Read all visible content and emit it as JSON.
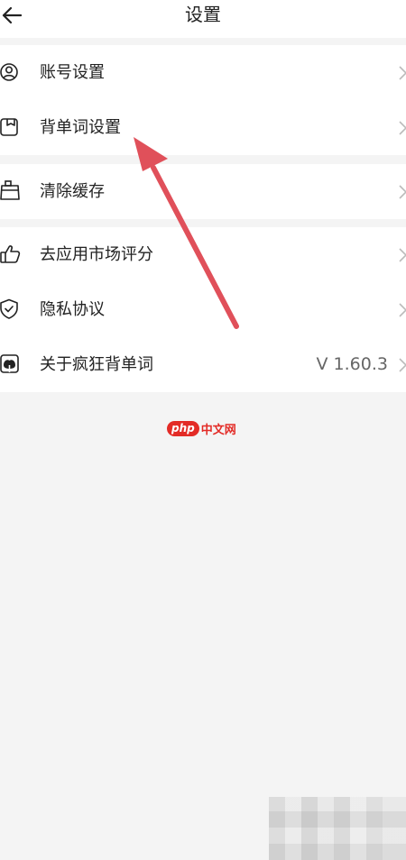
{
  "header": {
    "title": "设置"
  },
  "groups": [
    {
      "items": [
        {
          "label": "账号设置",
          "icon": "user-circle-icon"
        },
        {
          "label": "背单词设置",
          "icon": "bookmark-card-icon"
        }
      ]
    },
    {
      "items": [
        {
          "label": "清除缓存",
          "icon": "cleaning-brush-icon"
        }
      ]
    },
    {
      "items": [
        {
          "label": "去应用市场评分",
          "icon": "thumbs-up-icon"
        },
        {
          "label": "隐私协议",
          "icon": "shield-check-icon"
        },
        {
          "label": "关于疯狂背单词",
          "icon": "app-logo-icon",
          "value": "V 1.60.3"
        }
      ]
    }
  ],
  "watermark": {
    "brand": "php",
    "text": "中文网"
  },
  "colors": {
    "background": "#f4f4f4",
    "card": "#ffffff",
    "annotation_arrow": "#e0505a",
    "watermark_red": "#e32b26"
  }
}
